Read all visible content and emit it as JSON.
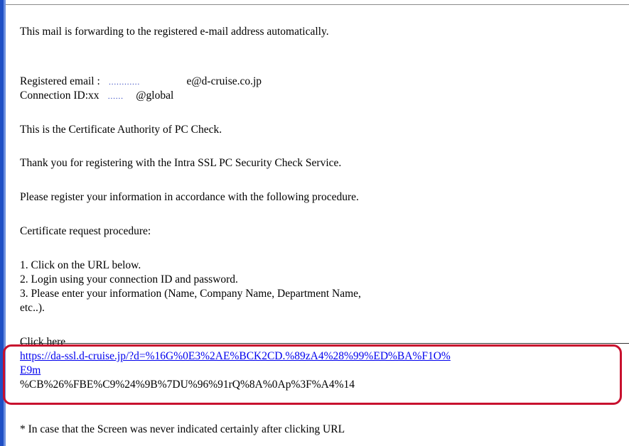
{
  "mail": {
    "intro": "This mail is forwarding to the registered e-mail address automatically.",
    "registered_label": "Registered email :",
    "registered_dots": "…………",
    "registered_suffix": "e@d-cruise.co.jp",
    "connection_label": "Connection ID:xx",
    "connection_dots": "……",
    "connection_suffix": "@global",
    "ca_line": "This is the Certificate Authority of PC Check.",
    "thanks_line": "Thank you for registering with the Intra SSL PC Security Check Service.",
    "register_line": "Please register your information in accordance with the following procedure.",
    "procedure_heading": "Certificate request procedure:",
    "step1": "1. Click on the URL below.",
    "step2": "2. Login using your connection ID and password.",
    "step3a": "3. Please enter your information (Name, Company Name, Department Name,",
    "step3b": "etc..).",
    "click_here": "Click here",
    "url_line1": "https://da-ssl.d-cruise.jp/?d=%16G%0E3%2AE%BCK2CD.%89zA4%28%99%ED%BA%F1O%",
    "url_line2": "E9m",
    "url_line3": "%CB%26%FBE%C9%24%9B%7DU%96%91rQ%8A%0Ap%3F%A4%14",
    "footnote": "* In case that the Screen was never indicated certainly after clicking URL"
  },
  "colors": {
    "frame_blue": "#1f4fc4",
    "link": "#0000ee",
    "highlight": "#c8102e"
  }
}
